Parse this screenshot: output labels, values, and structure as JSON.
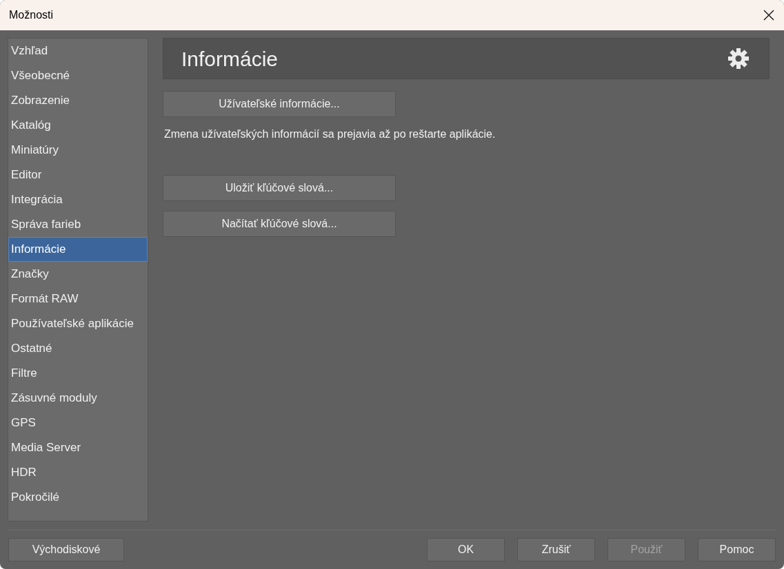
{
  "window": {
    "title": "Možnosti"
  },
  "sidebar": {
    "items": [
      {
        "label": "Vzhľad",
        "selected": false
      },
      {
        "label": "Všeobecné",
        "selected": false
      },
      {
        "label": "Zobrazenie",
        "selected": false
      },
      {
        "label": "Katalóg",
        "selected": false
      },
      {
        "label": "Miniatúry",
        "selected": false
      },
      {
        "label": "Editor",
        "selected": false
      },
      {
        "label": "Integrácia",
        "selected": false
      },
      {
        "label": "Správa farieb",
        "selected": false
      },
      {
        "label": "Informácie",
        "selected": true
      },
      {
        "label": "Značky",
        "selected": false
      },
      {
        "label": "Formát RAW",
        "selected": false
      },
      {
        "label": "Používateľské aplikácie",
        "selected": false
      },
      {
        "label": "Ostatné",
        "selected": false
      },
      {
        "label": "Filtre",
        "selected": false
      },
      {
        "label": "Zásuvné moduly",
        "selected": false
      },
      {
        "label": "GPS",
        "selected": false
      },
      {
        "label": "Media Server",
        "selected": false
      },
      {
        "label": "HDR",
        "selected": false
      },
      {
        "label": "Pokročilé",
        "selected": false
      }
    ]
  },
  "panel": {
    "title": "Informácie",
    "content": [
      {
        "kind": "button",
        "label": "Užívateľské informácie..."
      },
      {
        "kind": "text",
        "text": "Zmena užívateľských informácií sa prejavia až po reštarte aplikácie."
      },
      {
        "kind": "spacer"
      },
      {
        "kind": "button",
        "label": "Uložiť kľúčové slová..."
      },
      {
        "kind": "button",
        "label": "Načítať kľúčové slová..."
      }
    ]
  },
  "footer": {
    "left_button": {
      "label": "Východiskové",
      "disabled": false
    },
    "buttons": [
      {
        "label": "OK",
        "disabled": false
      },
      {
        "label": "Zrušiť",
        "disabled": false
      },
      {
        "label": "Použiť",
        "disabled": true
      },
      {
        "label": "Pomoc",
        "disabled": false
      }
    ]
  }
}
